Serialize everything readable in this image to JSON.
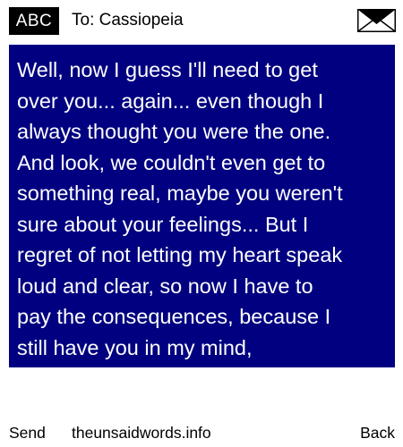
{
  "header": {
    "input_mode": "ABC",
    "recipient": "To: Cassiopeia",
    "icon": "envelope-icon"
  },
  "message": {
    "lines": [
      "Well, now I guess I'll need to get",
      "over you... again... even though I",
      "always thought you were the one.",
      "And look, we couldn't even get to",
      "something real, maybe you weren't",
      "sure about your feelings... But I",
      "regret of not letting my heart speak",
      "loud and clear, so now I have to",
      "pay the consequences, because I",
      "still have you in my mind,"
    ]
  },
  "footer": {
    "left_softkey": "Send",
    "site": "theunsaidwords.info",
    "right_softkey": "Back"
  },
  "colors": {
    "message_background": "#000080",
    "message_text": "#ffffff",
    "badge_background": "#000000",
    "badge_text": "#ffffff",
    "page_background": "#ffffff"
  }
}
